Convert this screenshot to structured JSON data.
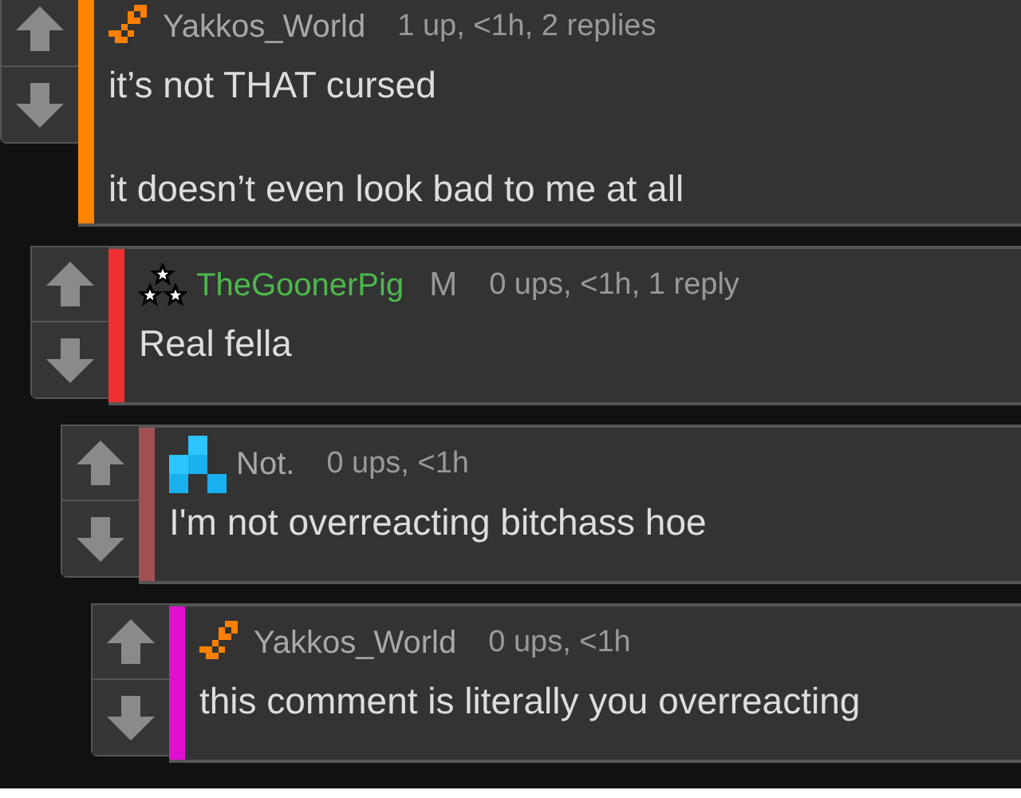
{
  "comments": [
    {
      "user": {
        "name": "Yakkos_World",
        "color": "#a8a8a8"
      },
      "avatar": {
        "kind": "chain"
      },
      "meta": "1 up, <1h, 2 replies",
      "color": "#ff8400",
      "lines": [
        "it’s not THAT cursed",
        "it doesn’t even look bad to me at all"
      ],
      "children": [
        {
          "user": {
            "name": "TheGoonerPig",
            "color": "#4cb84c"
          },
          "avatar": {
            "kind": "stars"
          },
          "badge": "M",
          "meta": "0 ups, <1h, 1 reply",
          "color": "#f03030",
          "lines": [
            "Real fella"
          ],
          "children": [
            {
              "user": {
                "name": "Not.",
                "color": "#a8a8a8"
              },
              "avatar": {
                "kind": "blocks"
              },
              "meta": "0 ups, <1h",
              "color": "#a05050",
              "lines": [
                "I'm not overreacting bitchass hoe"
              ],
              "children": [
                {
                  "user": {
                    "name": "Yakkos_World",
                    "color": "#a8a8a8"
                  },
                  "avatar": {
                    "kind": "chain"
                  },
                  "meta": "0 ups, <1h",
                  "color": "#e010d0",
                  "lines": [
                    "this comment is literally you overreacting"
                  ]
                }
              ]
            }
          ]
        }
      ]
    }
  ]
}
